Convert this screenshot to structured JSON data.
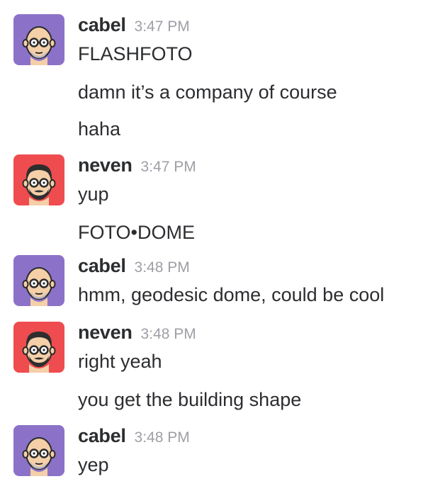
{
  "colors": {
    "cabel_avatar_bg": "#8b72c8",
    "neven_avatar_bg": "#ef4c4f",
    "author": "#2c2d30",
    "timestamp": "#9e9ea6",
    "message_text": "#2c2d30"
  },
  "messages": [
    {
      "author": "cabel",
      "avatar_icon": "cabel-avatar-icon",
      "time": "3:47 PM",
      "lines": [
        "FLASHFOTO",
        "damn it’s a company of course",
        "haha"
      ]
    },
    {
      "author": "neven",
      "avatar_icon": "neven-avatar-icon",
      "time": "3:47 PM",
      "lines": [
        "yup",
        "FOTO•DOME"
      ]
    },
    {
      "author": "cabel",
      "avatar_icon": "cabel-avatar-icon",
      "time": "3:48 PM",
      "lines": [
        "hmm, geodesic dome, could be cool"
      ]
    },
    {
      "author": "neven",
      "avatar_icon": "neven-avatar-icon",
      "time": "3:48 PM",
      "lines": [
        "right yeah",
        "you get the building shape"
      ]
    },
    {
      "author": "cabel",
      "avatar_icon": "cabel-avatar-icon",
      "time": "3:48 PM",
      "lines": [
        "yep"
      ]
    }
  ]
}
